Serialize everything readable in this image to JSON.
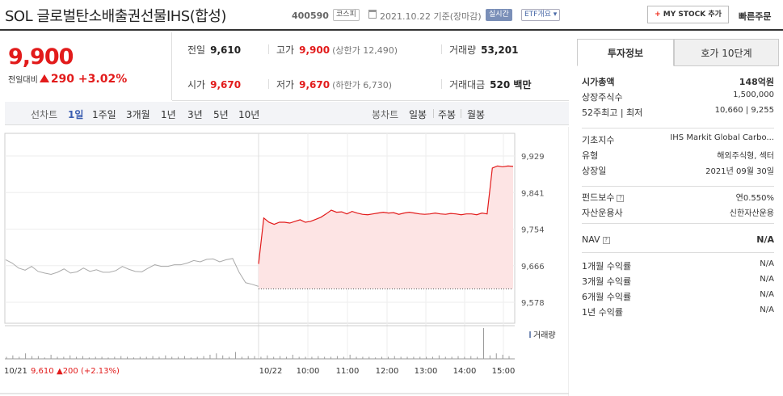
{
  "header": {
    "title": "SOL 글로벌탄소배출권선물IHS(합성)",
    "code": "400590",
    "market_badge": "코스피",
    "date_text": "2021.10.22  기준(장마감)",
    "realtime_badge": "실시간",
    "etf_badge": "ETF개요 ▾",
    "mystock_label": "MY STOCK 추가",
    "mystock_plus": "+",
    "quick_order": "빠른주문"
  },
  "price": {
    "current": "9,900",
    "change_label": "전일대비",
    "change_value": "290",
    "change_pct": "+3.02%"
  },
  "stats": {
    "prev_label": "전일",
    "prev_value": "9,610",
    "high_label": "고가",
    "high_value": "9,900",
    "high_sub": "(상한가 12,490)",
    "volume_label": "거래량",
    "volume_value": "53,201",
    "open_label": "시가",
    "open_value": "9,670",
    "low_label": "저가",
    "low_value": "9,670",
    "low_sub": "(하한가 6,730)",
    "amount_label": "거래대금",
    "amount_value": "520 백만"
  },
  "period_bar": {
    "line_label": "선차트",
    "line_periods": [
      "1일",
      "1주일",
      "3개월",
      "1년",
      "3년",
      "5년",
      "10년"
    ],
    "active_period": "1일",
    "candle_label": "봉차트",
    "candle_periods": [
      "일봉",
      "주봉",
      "월봉"
    ]
  },
  "colors": {
    "up": "#e21b1b",
    "area_fill": "#fde4e4",
    "prev_line": "#aaaaaa",
    "volume_bar": "#999999",
    "realtime_badge": "#7a8fb8"
  },
  "chart_data": {
    "type": "line",
    "title": "",
    "ylim": [
      9578,
      9929
    ],
    "yticks": [
      "9,929",
      "9,841",
      "9,754",
      "9,666",
      "9,578"
    ],
    "xticks": [
      "10/22",
      "10:00",
      "11:00",
      "12:00",
      "13:00",
      "14:00",
      "15:00"
    ],
    "volume_label": "거래량",
    "prev_day_label": "10/21",
    "prev_day_close": "9,610",
    "prev_day_change": "▲200 (+2.13%)",
    "baseline": 9610,
    "series": [
      {
        "values": [
          9680,
          9672,
          9660,
          9655,
          9664,
          9652,
          9648,
          9645,
          9650,
          9658,
          9648,
          9651,
          9660,
          9652,
          9656,
          9650,
          9650,
          9654,
          9664,
          9657,
          9652,
          9651,
          9660,
          9668,
          9664,
          9664,
          9668,
          9668,
          9672,
          9678,
          9675,
          9681,
          9682,
          9675,
          9680,
          9683,
          9650,
          9625,
          9621,
          9616
        ]
      },
      {
        "values": [
          9670,
          9780,
          9770,
          9765,
          9770,
          9770,
          9768,
          9772,
          9776,
          9770,
          9772,
          9777,
          9782,
          9790,
          9799,
          9794,
          9795,
          9790,
          9796,
          9792,
          9789,
          9788,
          9790,
          9792,
          9794,
          9792,
          9793,
          9789,
          9792,
          9794,
          9792,
          9790,
          9789,
          9790,
          9792,
          9790,
          9789,
          9791,
          9790,
          9788,
          9790,
          9790,
          9788,
          9792,
          9790,
          9900,
          9905,
          9903,
          9905,
          9904
        ]
      }
    ],
    "volume": [
      3,
      5,
      3,
      8,
      4,
      4,
      2,
      6,
      3,
      3,
      5,
      3,
      4,
      2,
      3,
      3,
      2,
      3,
      4,
      3,
      2,
      3,
      3,
      4,
      3,
      5,
      3,
      3,
      4,
      2,
      3,
      4,
      6,
      8,
      5,
      3,
      10,
      3,
      4,
      4,
      3,
      5,
      3,
      4,
      3,
      6,
      3,
      3,
      3,
      4,
      3,
      3,
      4,
      3,
      6,
      3,
      3,
      3,
      2,
      3,
      3,
      4,
      3,
      3,
      3,
      3,
      3,
      3,
      5,
      3,
      3,
      4,
      3,
      4,
      3,
      45,
      5,
      8,
      6,
      4
    ]
  },
  "right_panel": {
    "tab_active": "투자정보",
    "tab_inactive": "호가 10단계",
    "rows_group1": [
      {
        "k": "시가총액",
        "v": "148억원",
        "bold": true
      },
      {
        "k": "상장주식수",
        "v": "1,500,000"
      },
      {
        "k": "52주최고 | 최저",
        "v": "10,660 | 9,255"
      }
    ],
    "rows_group2": [
      {
        "k": "기초지수",
        "v": "IHS Markit Global Carbo..."
      },
      {
        "k": "유형",
        "v": "해외주식형, 섹터"
      },
      {
        "k": "상장일",
        "v": "2021년 09월 30일"
      }
    ],
    "rows_group3": [
      {
        "k": "펀드보수",
        "v": "연0.550%",
        "q": true
      },
      {
        "k": "자산운용사",
        "v": "신한자산운용"
      }
    ],
    "nav": {
      "k": "NAV",
      "v": "N/A"
    },
    "returns": [
      {
        "k": "1개월 수익률",
        "v": "N/A"
      },
      {
        "k": "3개월 수익률",
        "v": "N/A"
      },
      {
        "k": "6개월 수익률",
        "v": "N/A"
      },
      {
        "k": "1년 수익률",
        "v": "N/A"
      }
    ],
    "help_icon": "?"
  }
}
